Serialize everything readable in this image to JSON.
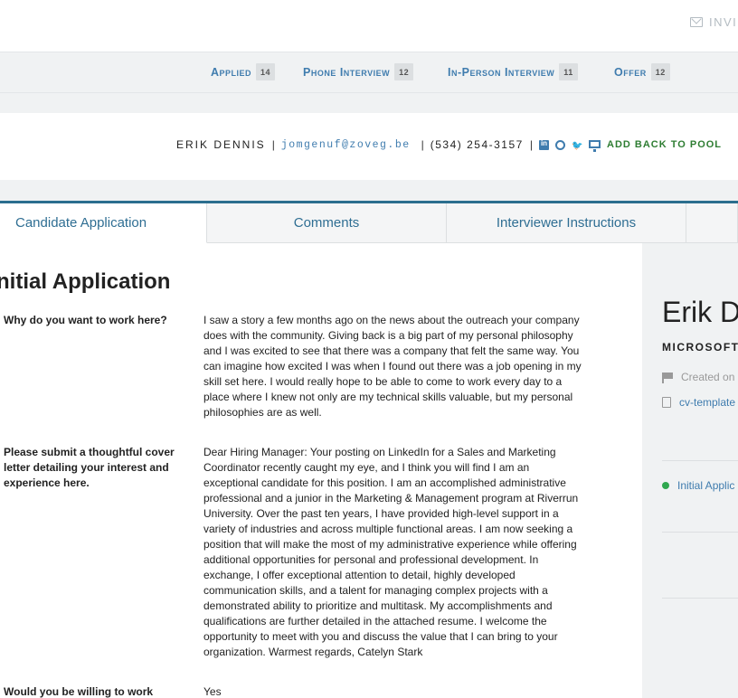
{
  "header": {
    "invite_label": "INVI"
  },
  "stages": [
    {
      "label": "Applied",
      "count": "14"
    },
    {
      "label": "Phone Interview",
      "count": "12"
    },
    {
      "label": "In-Person Interview",
      "count": "11"
    },
    {
      "label": "Offer",
      "count": "12"
    }
  ],
  "candidate": {
    "name": "ERIK DENNIS",
    "separator": "|",
    "email": "jomgenuf@zoveg.be",
    "phone": "(534) 254-3157",
    "add_back": "ADD BACK TO POOL"
  },
  "tabs": [
    {
      "label": "Candidate Application"
    },
    {
      "label": "Comments"
    },
    {
      "label": "Interviewer Instructions"
    }
  ],
  "application": {
    "title": "nitial Application",
    "questions": [
      {
        "q": "Why do you want to work here?",
        "a": "I saw a story a few months ago on the news about the outreach your company does with the community. Giving back is a big part of my personal philosophy and I was excited to see that there was a company that felt the same way. You can imagine how excited I was when I found out there was a job opening in my skill set here. I would really hope to be able to come to work every day to a place where I knew not only are my technical skills valuable, but my personal philosophies are as well."
      },
      {
        "q": "Please submit a thoughtful cover letter detailing your interest and experience here.",
        "a": "Dear Hiring Manager: Your posting on LinkedIn for a Sales and Marketing Coordinator recently caught my eye, and I think you will find I am an exceptional candidate for this position. I am an accomplished administrative professional and a junior in the Marketing & Management program at Riverrun University. Over the past ten years, I have provided high-level support in a variety of industries and across multiple functional areas. I am now seeking a position that will make the most of my administrative experience while offering additional opportunities for personal and professional development. In exchange, I offer exceptional attention to detail, highly developed communication skills, and a talent for managing complex projects with a demonstrated ability to prioritize and multitask. My accomplishments and qualifications are further detailed in the attached resume. I welcome the opportunity to meet with you and discuss the value that I can bring to your organization. Warmest regards, Catelyn Stark"
      },
      {
        "q": "Would you be willing to work",
        "a": "Yes"
      }
    ]
  },
  "sidebar": {
    "name": "Erik D",
    "company": "MICROSOFT",
    "created": "Created on",
    "cv_file": "cv-template",
    "stage_link": "Initial Applic"
  },
  "icons": {
    "invite": "envelope-icon",
    "linkedin": "linkedin-icon",
    "github": "github-icon",
    "twitter": "twitter-icon",
    "website": "desktop-icon",
    "created": "flag-icon",
    "cv": "pdf-file-icon",
    "stage": "status-dot-icon"
  },
  "colors": {
    "accent": "#3f7cae",
    "tab_border": "#2b6e8e",
    "success": "#2e7d32",
    "status_dot": "#2fa84f"
  }
}
